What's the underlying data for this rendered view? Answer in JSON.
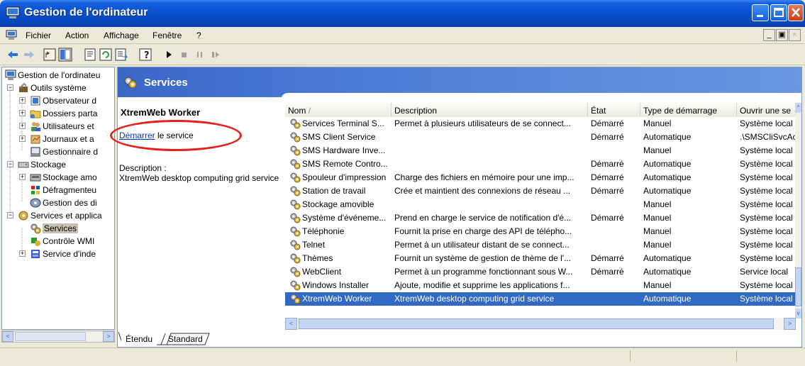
{
  "window": {
    "title": "Gestion de l'ordinateur",
    "accent": "#0a4fcc"
  },
  "menubar": {
    "items": [
      "Fichier",
      "Action",
      "Affichage",
      "Fenêtre",
      "?"
    ]
  },
  "tree": {
    "items": [
      {
        "label": "Gestion de l'ordinateu",
        "icon": "computer-icon"
      },
      {
        "label": "Outils système",
        "icon": "tools-icon"
      },
      {
        "label": "Observateur d",
        "icon": "event-viewer-icon"
      },
      {
        "label": "Dossiers parta",
        "icon": "shared-folder-icon"
      },
      {
        "label": "Utilisateurs et",
        "icon": "users-icon"
      },
      {
        "label": "Journaux et a",
        "icon": "logs-icon"
      },
      {
        "label": "Gestionnaire d",
        "icon": "device-manager-icon"
      },
      {
        "label": "Stockage",
        "icon": "storage-icon"
      },
      {
        "label": "Stockage amo",
        "icon": "removable-storage-icon"
      },
      {
        "label": "Défragmenteu",
        "icon": "defrag-icon"
      },
      {
        "label": "Gestion des di",
        "icon": "disk-management-icon"
      },
      {
        "label": "Services et applica",
        "icon": "services-apps-icon"
      },
      {
        "label": "Services",
        "icon": "gear-icon"
      },
      {
        "label": "Contrôle WMI",
        "icon": "wmi-icon"
      },
      {
        "label": "Service d'inde",
        "icon": "indexing-icon"
      }
    ]
  },
  "main": {
    "banner_title": "Services",
    "panel": {
      "service_name": "XtremWeb Worker",
      "start_link": "Démarrer",
      "start_rest": " le service",
      "description_label": "Description :",
      "description_text": "XtremWeb desktop computing grid service"
    },
    "columns": [
      "Nom",
      "Description",
      "État",
      "Type de démarrage",
      "Ouvrir une se"
    ],
    "rows": [
      {
        "name": "Services Terminal S...",
        "desc": "Permet à plusieurs utilisateurs de se connect...",
        "state": "Démarré",
        "type": "Manuel",
        "logon": "Système local"
      },
      {
        "name": "SMS Client Service",
        "desc": "",
        "state": "Démarré",
        "type": "Automatique",
        "logon": ".\\SMSCliSvcAc"
      },
      {
        "name": "SMS Hardware Inve...",
        "desc": "",
        "state": "",
        "type": "Manuel",
        "logon": "Système local"
      },
      {
        "name": "SMS Remote Contro...",
        "desc": "",
        "state": "Démarré",
        "type": "Automatique",
        "logon": "Système local"
      },
      {
        "name": "Spouleur d'impression",
        "desc": "Charge des fichiers en mémoire pour une imp...",
        "state": "Démarré",
        "type": "Automatique",
        "logon": "Système local"
      },
      {
        "name": "Station de travail",
        "desc": "Crée et maintient des connexions de réseau ...",
        "state": "Démarré",
        "type": "Automatique",
        "logon": "Système local"
      },
      {
        "name": "Stockage amovible",
        "desc": "",
        "state": "",
        "type": "Manuel",
        "logon": "Système local"
      },
      {
        "name": "Système d'événeme...",
        "desc": "Prend en charge le service de notification d'é...",
        "state": "Démarré",
        "type": "Manuel",
        "logon": "Système local"
      },
      {
        "name": "Téléphonie",
        "desc": "Fournit la prise en charge des API de télépho...",
        "state": "",
        "type": "Manuel",
        "logon": "Système local"
      },
      {
        "name": "Telnet",
        "desc": "Permet à un utilisateur distant de se connect...",
        "state": "",
        "type": "Manuel",
        "logon": "Système local"
      },
      {
        "name": "Thèmes",
        "desc": "Fournit un système de gestion de thème de l'...",
        "state": "Démarré",
        "type": "Automatique",
        "logon": "Système local"
      },
      {
        "name": "WebClient",
        "desc": "Permet à un programme fonctionnant sous W...",
        "state": "Démarré",
        "type": "Automatique",
        "logon": "Service local"
      },
      {
        "name": "Windows Installer",
        "desc": "Ajoute, modifie et supprime les applications f...",
        "state": "",
        "type": "Manuel",
        "logon": "Système local"
      },
      {
        "name": "XtremWeb Worker",
        "desc": "XtremWeb desktop computing grid service",
        "state": "",
        "type": "Automatique",
        "logon": "Système local",
        "selected": true
      }
    ],
    "tabs": [
      "Étendu",
      "Standard"
    ],
    "highlight_color": "#e8201c",
    "selection_color": "#316ac5"
  }
}
